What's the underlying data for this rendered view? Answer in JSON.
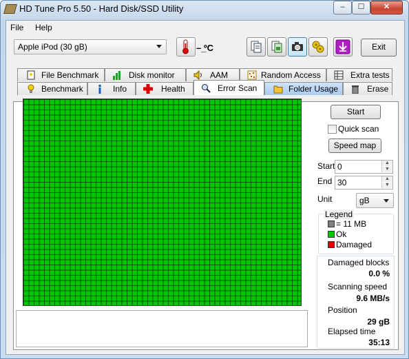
{
  "window": {
    "title": "HD Tune Pro 5.50 - Hard Disk/SSD Utility"
  },
  "caption_buttons": {
    "minimize": "‒",
    "maximize": "☐",
    "close": "✕"
  },
  "menu": {
    "file": "File",
    "help": "Help"
  },
  "toolbar": {
    "drive": "Apple   iPod (30 gB)",
    "temperature": "– ̲ºC",
    "exit": "Exit",
    "icons": [
      "copy-text-icon",
      "copy-screenshot-icon",
      "camera-icon",
      "options-icon",
      "download-icon"
    ]
  },
  "tabs": {
    "top": [
      "File Benchmark",
      "Disk monitor",
      "AAM",
      "Random Access",
      "Extra tests"
    ],
    "bottom": [
      "Benchmark",
      "Info",
      "Health",
      "Error Scan",
      "Folder Usage",
      "Erase"
    ],
    "active": "Error Scan"
  },
  "controls": {
    "start_button": "Start",
    "quick_scan": "Quick scan",
    "quick_scan_checked": false,
    "speed_map_button": "Speed map",
    "start_label": "Start",
    "start_value": "0",
    "end_label": "End",
    "end_value": "30",
    "unit_label": "Unit",
    "unit_value": "gB"
  },
  "legend": {
    "title": "Legend",
    "block": "= 11 MB",
    "ok": "Ok",
    "damaged": "Damaged"
  },
  "colors": {
    "ok": "#00c800",
    "damaged": "#e00000",
    "block": "#808080"
  },
  "stats": {
    "damaged_blocks_label": "Damaged blocks",
    "damaged_blocks_value": "0.0 %",
    "scanning_speed_label": "Scanning speed",
    "scanning_speed_value": "9.6 MB/s",
    "position_label": "Position",
    "position_value": "29 gB",
    "elapsed_time_label": "Elapsed time",
    "elapsed_time_value": "35:13"
  }
}
